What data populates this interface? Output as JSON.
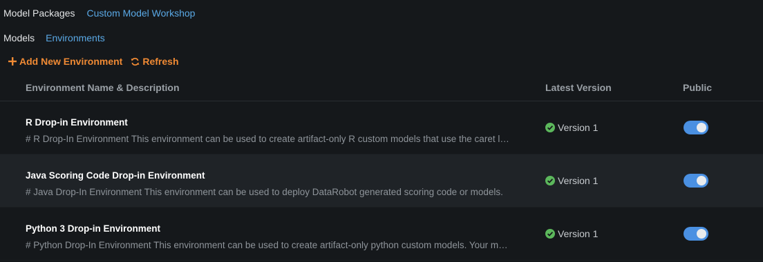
{
  "top_tabs": [
    {
      "label": "Model Packages"
    },
    {
      "label": "Custom Model Workshop"
    }
  ],
  "sub_tabs": [
    {
      "label": "Models"
    },
    {
      "label": "Environments"
    }
  ],
  "actions": {
    "add_label": "Add New Environment",
    "refresh_label": "Refresh"
  },
  "table": {
    "headers": {
      "name": "Environment Name & Description",
      "version": "Latest Version",
      "public": "Public"
    },
    "rows": [
      {
        "title": "R Drop-in Environment",
        "description": "# R Drop-In Environment This environment can be used to create artifact-only R custom models that use the caret library.",
        "version": "Version 1",
        "public": true
      },
      {
        "title": "Java Scoring Code Drop-in Environment",
        "description": "# Java Drop-In Environment This environment can be used to deploy DataRobot generated scoring code or models.",
        "version": "Version 1",
        "public": true
      },
      {
        "title": "Python 3 Drop-in Environment",
        "description": "# Python Drop-In Environment This environment can be used to create artifact-only python custom models. Your model.",
        "version": "Version 1",
        "public": true
      }
    ]
  },
  "colors": {
    "accent": "#f08a34",
    "link": "#5aa9e6",
    "success": "#5cb85c",
    "toggle_on": "#4a90e2"
  },
  "icons": {
    "add": "plus-icon",
    "refresh": "refresh-icon",
    "version_status": "check-circle-icon"
  }
}
